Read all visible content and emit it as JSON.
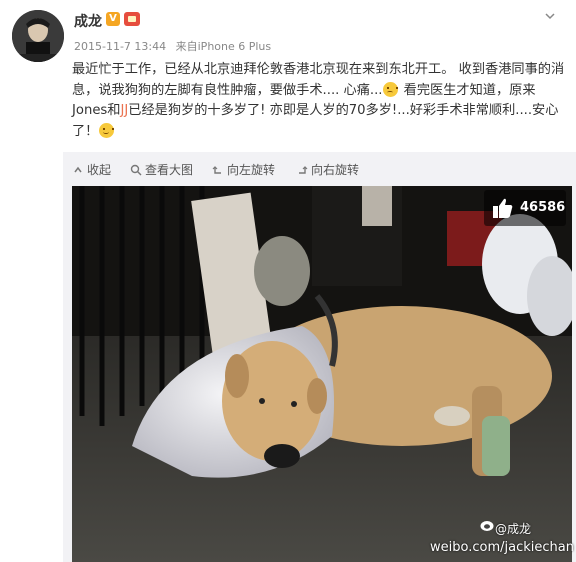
{
  "user": {
    "name": "成龙",
    "verified_badge": "V"
  },
  "meta": {
    "time": "2015-11-7 13:44",
    "source_prefix": "来自",
    "source": "iPhone 6 Plus"
  },
  "post": {
    "seg1": "最近忙于工作，已经从北京迪拜伦敦香港北京现在来到东北开工。 收到香港同事的消息，说我狗狗的左脚有良性肿瘤，要做手术.... 心痛...",
    "seg2": " 看完医生才知道，原来Jones和",
    "highlight": "JJ",
    "seg3": "已经是狗岁的十多岁了! 亦即是人岁的70多岁!...好彩手术非常顺利....安心了！"
  },
  "toolbar": {
    "collapse": "收起",
    "view_large": "查看大图",
    "rotate_left": "向左旋转",
    "rotate_right": "向右旋转"
  },
  "like": {
    "count": "46586"
  },
  "watermark": {
    "handle": "@成龙",
    "url": "weibo.com/jackiechan"
  },
  "icons": [
    "chevron-down-icon",
    "search-icon",
    "rotate-left-icon",
    "rotate-right-icon",
    "thumbs-up-icon",
    "weibo-logo-icon"
  ]
}
